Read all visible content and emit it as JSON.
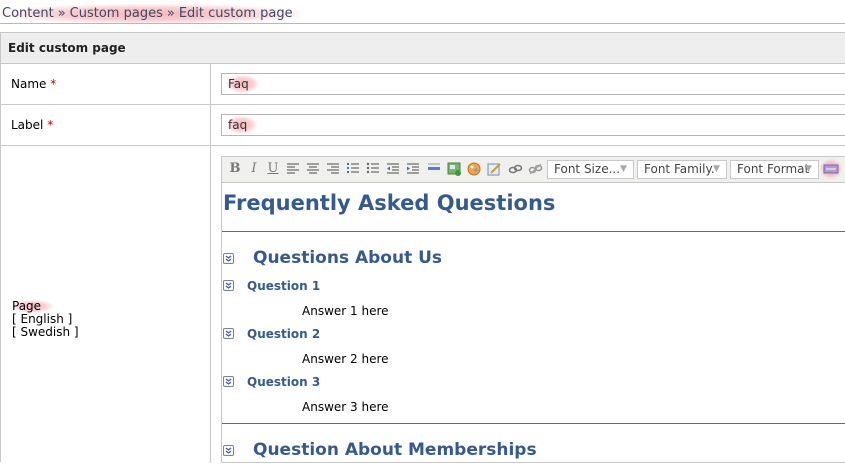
{
  "breadcrumb": {
    "items": [
      "Content",
      "Custom pages",
      "Edit custom page"
    ],
    "separator": "»"
  },
  "form": {
    "title": "Edit custom page",
    "name": {
      "label": "Name",
      "required_mark": "*",
      "value": "Faq"
    },
    "label_field": {
      "label": "Label",
      "required_mark": "*",
      "value": "faq"
    },
    "page": {
      "label": "Page",
      "languages": [
        "[ English ]",
        "[ Swedish ]"
      ]
    }
  },
  "editor": {
    "toolbar": {
      "bold": "B",
      "italic": "I",
      "underline": "U",
      "font_size": "Font Size...",
      "font_family": "Font Family.",
      "font_format": "Font Format",
      "icons": [
        "align-left-icon",
        "align-center-icon",
        "align-right-icon",
        "ordered-list-icon",
        "unordered-list-icon",
        "outdent-icon",
        "indent-icon",
        "horizontal-rule-icon",
        "insert-image-icon",
        "insert-media-icon",
        "edit-icon",
        "link-icon",
        "unlink-icon",
        "html-source-icon"
      ]
    },
    "content": {
      "heading": "Frequently Asked Questions",
      "sections": [
        {
          "title": "Questions About Us",
          "questions": [
            {
              "q": "Question 1",
              "a": "Answer 1 here"
            },
            {
              "q": "Question 2",
              "a": "Answer 2 here"
            },
            {
              "q": "Question 3",
              "a": "Answer 3 here"
            }
          ]
        },
        {
          "title": "Question About Memberships",
          "questions": []
        }
      ]
    }
  },
  "colors": {
    "accent": "#365a8c",
    "required": "#c00000",
    "highlight": "#f07882"
  }
}
